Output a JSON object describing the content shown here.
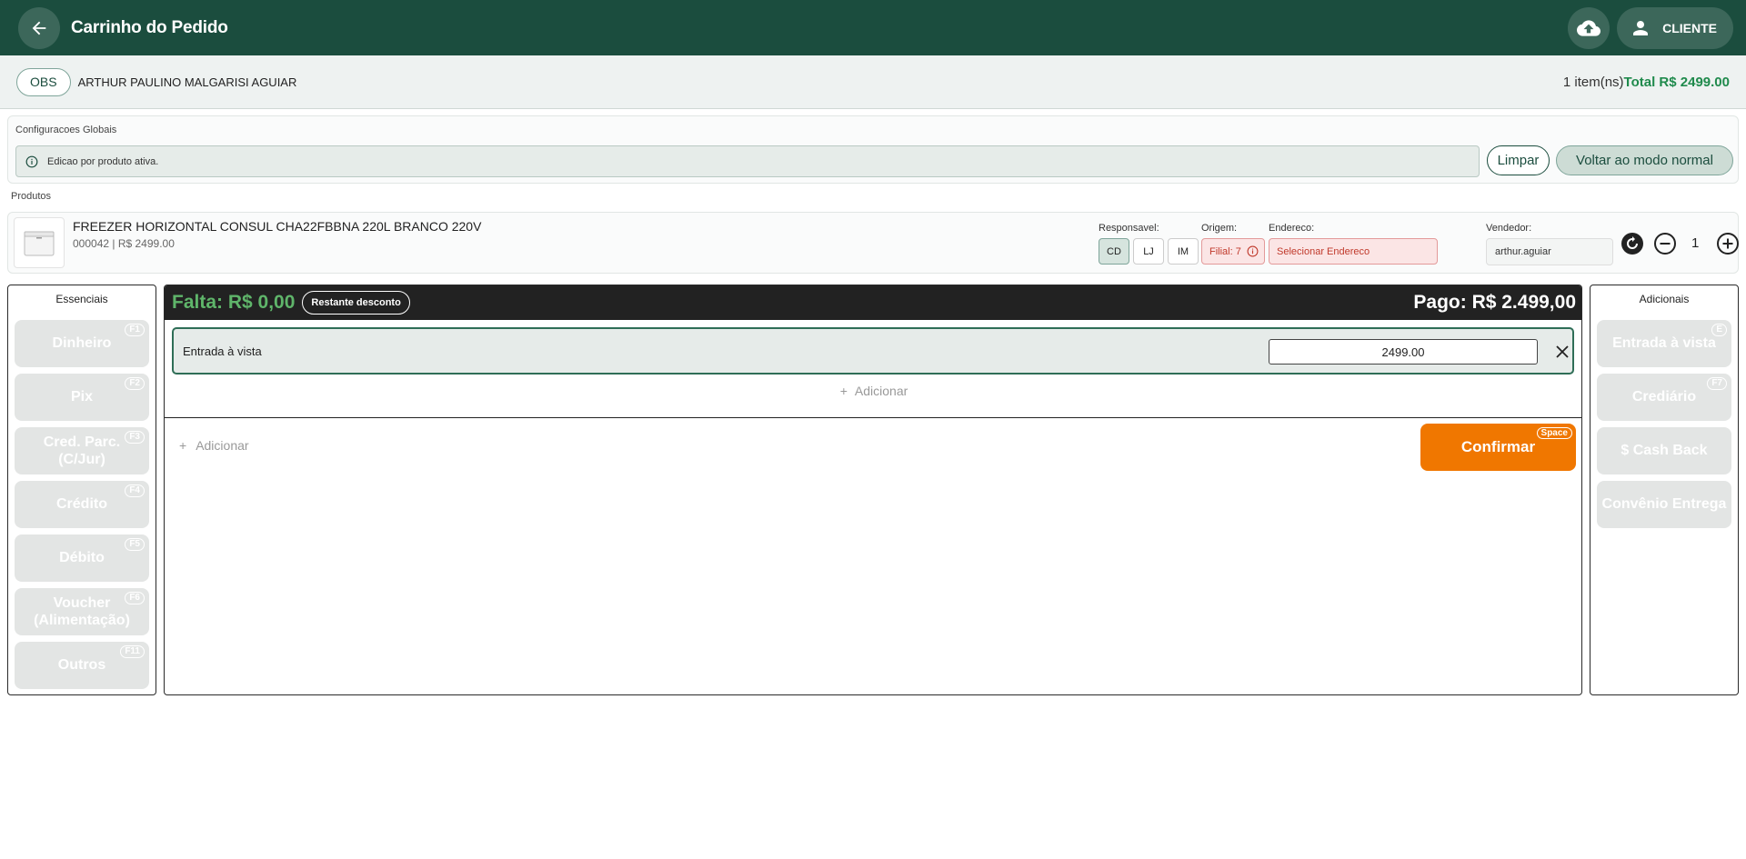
{
  "header": {
    "title": "Carrinho do Pedido",
    "client_label": "CLIENTE"
  },
  "client_bar": {
    "obs_label": "OBS",
    "client_name": "ARTHUR PAULINO MALGARISI AGUIAR",
    "items_count": "1 item(ns)",
    "total": "Total R$ 2499.00"
  },
  "global_config": {
    "title": "Configuracoes Globais",
    "info_text": "Edicao por produto ativa.",
    "clear_label": "Limpar",
    "back_normal_label": "Voltar ao modo normal"
  },
  "products": {
    "label": "Produtos",
    "items": [
      {
        "name": "FREEZER HORIZONTAL CONSUL CHA22FBBNA 220L BRANCO 220V",
        "meta": "000042  |  R$ 2499.00",
        "responsavel_label": "Responsavel:",
        "responsavel_options": [
          "CD",
          "LJ",
          "IM"
        ],
        "responsavel_selected": "CD",
        "origem_label": "Origem:",
        "origem_value": "Filial: 7",
        "endereco_label": "Endereco:",
        "endereco_value": "Selecionar Endereco",
        "vendedor_label": "Vendedor:",
        "vendedor_value": "arthur.aguiar",
        "quantity": "1"
      }
    ]
  },
  "essenciais": {
    "title": "Essenciais",
    "buttons": [
      {
        "label": "Dinheiro",
        "key": "F1"
      },
      {
        "label": "Pix",
        "key": "F2"
      },
      {
        "label": "Cred. Parc. (C/Jur)",
        "key": "F3"
      },
      {
        "label": "Crédito",
        "key": "F4"
      },
      {
        "label": "Débito",
        "key": "F5"
      },
      {
        "label": "Voucher (Alimentação)",
        "key": "F6"
      },
      {
        "label": "Outros",
        "key": "F11"
      }
    ]
  },
  "payment": {
    "falta": "Falta: R$ 0,00",
    "restante_label": "Restante desconto",
    "pago": "Pago: R$ 2.499,00",
    "entry_label": "Entrada à vista",
    "entry_value": "2499.00",
    "add_inner": "Adicionar",
    "add_outer": "Adicionar",
    "confirm_label": "Confirmar",
    "confirm_key": "Space"
  },
  "adicionais": {
    "title": "Adicionais",
    "buttons": [
      {
        "label": "Entrada à vista",
        "key": "E"
      },
      {
        "label": "Crediário",
        "key": "F7"
      },
      {
        "label": "$ Cash Back",
        "key": ""
      },
      {
        "label": "Convênio Entrega",
        "key": ""
      }
    ]
  },
  "colors": {
    "brand": "#1b4d3e",
    "accent_orange": "#f07700",
    "success_green": "#1f8a4c",
    "error_red": "#c0392b"
  }
}
